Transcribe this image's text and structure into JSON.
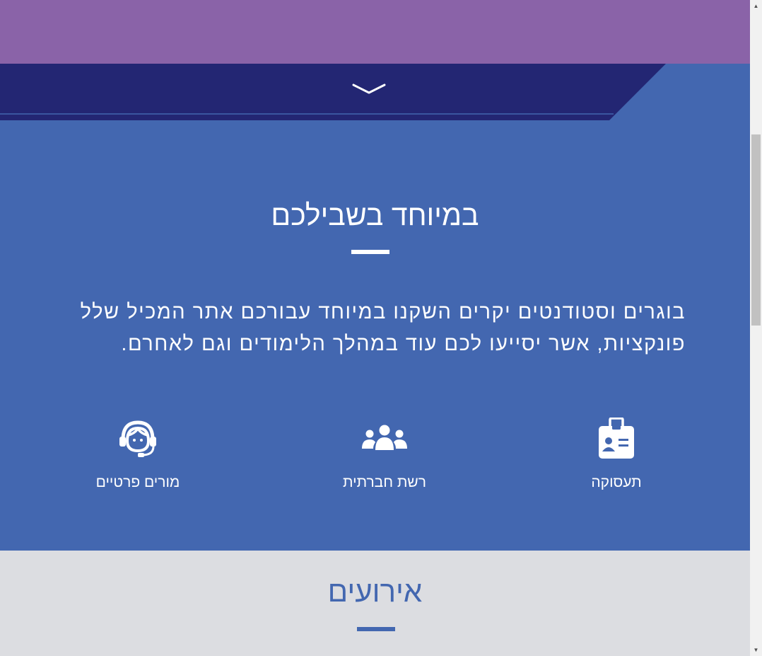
{
  "section": {
    "title": "במיוחד בשבילכם",
    "intro": "בוגרים וסטודנטים יקרים השקנו במיוחד עבורכם אתר המכיל שלל פונקציות, אשר יסייעו לכם עוד במהלך הלימודים וגם לאחרם."
  },
  "features": {
    "employment": {
      "label": "תעסוקה",
      "icon": "id-badge-icon"
    },
    "social": {
      "label": "רשת חברתית",
      "icon": "users-icon"
    },
    "tutors": {
      "label": "מורים פרטיים",
      "icon": "headset-person-icon"
    }
  },
  "events": {
    "title": "אירועים"
  },
  "colors": {
    "hero": "#8a63a8",
    "primary": "#4367b0",
    "navy": "#232673",
    "events_bg": "#dcdde1",
    "white": "#ffffff"
  }
}
